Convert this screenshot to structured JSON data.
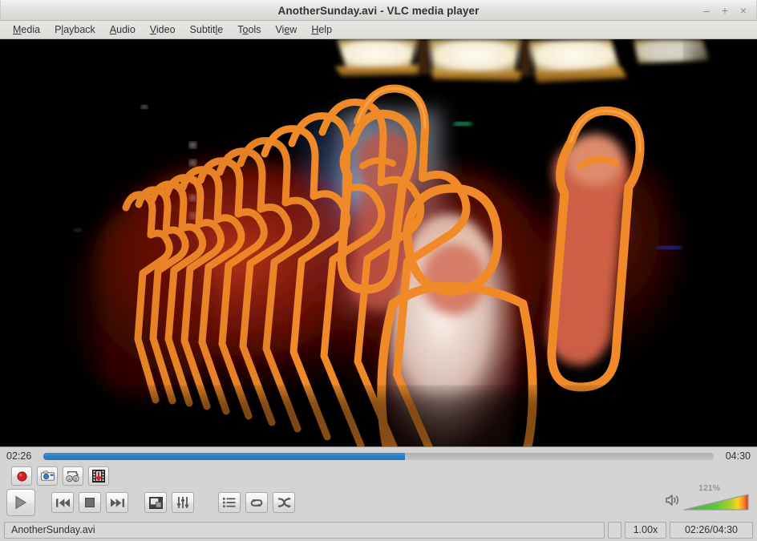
{
  "window": {
    "title": "AnotherSunday.avi - VLC media player",
    "controls": {
      "minimize": "–",
      "maximize": "+",
      "close": "×"
    }
  },
  "menubar": {
    "items": [
      {
        "label": "Media",
        "mnemonic_index": 0
      },
      {
        "label": "Playback",
        "mnemonic_index": 1
      },
      {
        "label": "Audio",
        "mnemonic_index": 0
      },
      {
        "label": "Video",
        "mnemonic_index": 0
      },
      {
        "label": "Subtitle",
        "mnemonic_index": 6
      },
      {
        "label": "Tools",
        "mnemonic_index": 1
      },
      {
        "label": "View",
        "mnemonic_index": 2
      },
      {
        "label": "Help",
        "mnemonic_index": 0
      }
    ]
  },
  "video": {
    "description": "Dark concert/venue scene with bright ceiling skylight panels; a person in white with raised fists, rendered with an orange motion-trail edge-outline video filter producing many repeated receding outlines toward the left.",
    "background_color": "#000000",
    "trail_color": "#f08a28",
    "trail_highlight": "#ffb259"
  },
  "seek": {
    "elapsed": "02:26",
    "total": "04:30",
    "progress_percent": 54,
    "fill_color": "#2b7fc4",
    "track_color": "#b8b8b8"
  },
  "toolbar_row1": [
    {
      "name": "record-button",
      "icon": "record-icon",
      "tooltip": "Record"
    },
    {
      "name": "snapshot-button",
      "icon": "snapshot-icon",
      "tooltip": "Take a snapshot"
    },
    {
      "name": "ab-loop-button",
      "icon": "ab-loop-icon",
      "tooltip": "Loop from point A to point B continuously"
    },
    {
      "name": "frame-by-frame-button",
      "icon": "frame-by-frame-icon",
      "tooltip": "Frame by frame"
    }
  ],
  "toolbar_row2": [
    {
      "name": "play-button",
      "icon": "play-icon",
      "tooltip": "Play"
    },
    {
      "name": "previous-button",
      "icon": "previous-icon",
      "tooltip": "Previous media in the playlist"
    },
    {
      "name": "stop-button",
      "icon": "stop-icon",
      "tooltip": "Stop playback"
    },
    {
      "name": "next-button",
      "icon": "next-icon",
      "tooltip": "Next media in the playlist"
    },
    {
      "name": "fullscreen-button",
      "icon": "fullscreen-icon",
      "tooltip": "Toggle the video in fullscreen"
    },
    {
      "name": "extended-settings-button",
      "icon": "equalizer-icon",
      "tooltip": "Show extended settings"
    },
    {
      "name": "playlist-button",
      "icon": "playlist-icon",
      "tooltip": "Show playlist"
    },
    {
      "name": "loop-button",
      "icon": "loop-icon",
      "tooltip": "Click to toggle between loop all, loop one and no loop"
    },
    {
      "name": "shuffle-button",
      "icon": "shuffle-icon",
      "tooltip": "Random"
    }
  ],
  "volume": {
    "percent_label": "121%",
    "percent_value": 121,
    "icon": "speaker-icon",
    "gradient": [
      "#3fb54a",
      "#8fcf3a",
      "#ffd21e",
      "#f08a28",
      "#e03020"
    ]
  },
  "statusbar": {
    "filename": "AnotherSunday.avi",
    "speed": "1.00x",
    "time": "02:26/04:30"
  },
  "colors": {
    "chrome": "#d3d3d3",
    "text": "#2e3436",
    "accent": "#2b7fc4"
  }
}
